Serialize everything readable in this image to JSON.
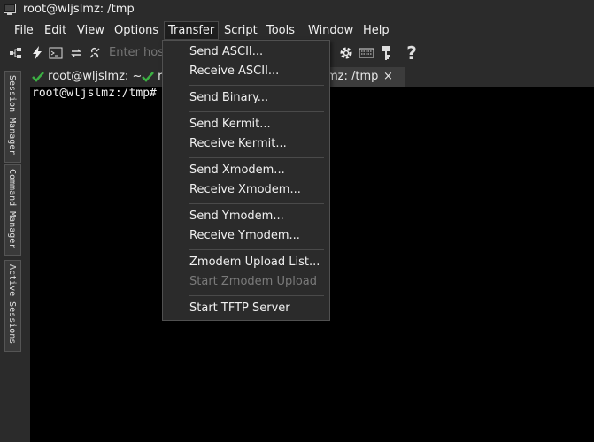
{
  "window": {
    "title": "root@wljslmz: /tmp"
  },
  "menubar": {
    "items": [
      "File",
      "Edit",
      "View",
      "Options",
      "Transfer",
      "Script",
      "Tools",
      "Window",
      "Help"
    ],
    "active": "Transfer"
  },
  "toolbar": {
    "host_placeholder": "Enter host",
    "icons": [
      "connect-icon",
      "quick-connect-icon",
      "terminal-icon",
      "reconnect-icon",
      "disconnect-icon",
      "settings-icon",
      "keymap-icon",
      "key-icon",
      "help-icon"
    ]
  },
  "tabs": [
    {
      "label": "root@wljslmz: ~",
      "status": "connected"
    },
    {
      "label": "ro",
      "status": "connected"
    },
    {
      "label": "mz: /tmp",
      "status": "connected",
      "active": true,
      "close_glyph": "×"
    }
  ],
  "sidebar": {
    "panels": [
      "Session Manager",
      "Command Manager",
      "Active Sessions"
    ]
  },
  "terminal": {
    "lines": [
      "root@wljslmz:/tmp#"
    ]
  },
  "transfer_menu": {
    "groups": [
      [
        {
          "label": "Send ASCII...",
          "enabled": true
        },
        {
          "label": "Receive ASCII...",
          "enabled": true
        }
      ],
      [
        {
          "label": "Send Binary...",
          "enabled": true
        }
      ],
      [
        {
          "label": "Send Kermit...",
          "enabled": true
        },
        {
          "label": "Receive Kermit...",
          "enabled": true
        }
      ],
      [
        {
          "label": "Send Xmodem...",
          "enabled": true
        },
        {
          "label": "Receive Xmodem...",
          "enabled": true
        }
      ],
      [
        {
          "label": "Send Ymodem...",
          "enabled": true
        },
        {
          "label": "Receive Ymodem...",
          "enabled": true
        }
      ],
      [
        {
          "label": "Zmodem Upload List...",
          "enabled": true
        },
        {
          "label": "Start Zmodem Upload",
          "enabled": false
        }
      ],
      [
        {
          "label": "Start TFTP Server",
          "enabled": true
        }
      ]
    ]
  },
  "colors": {
    "background": "#2b2b2b",
    "terminal_bg": "#000000",
    "check_green": "#3cb043",
    "disabled_text": "#7a7a7a"
  }
}
